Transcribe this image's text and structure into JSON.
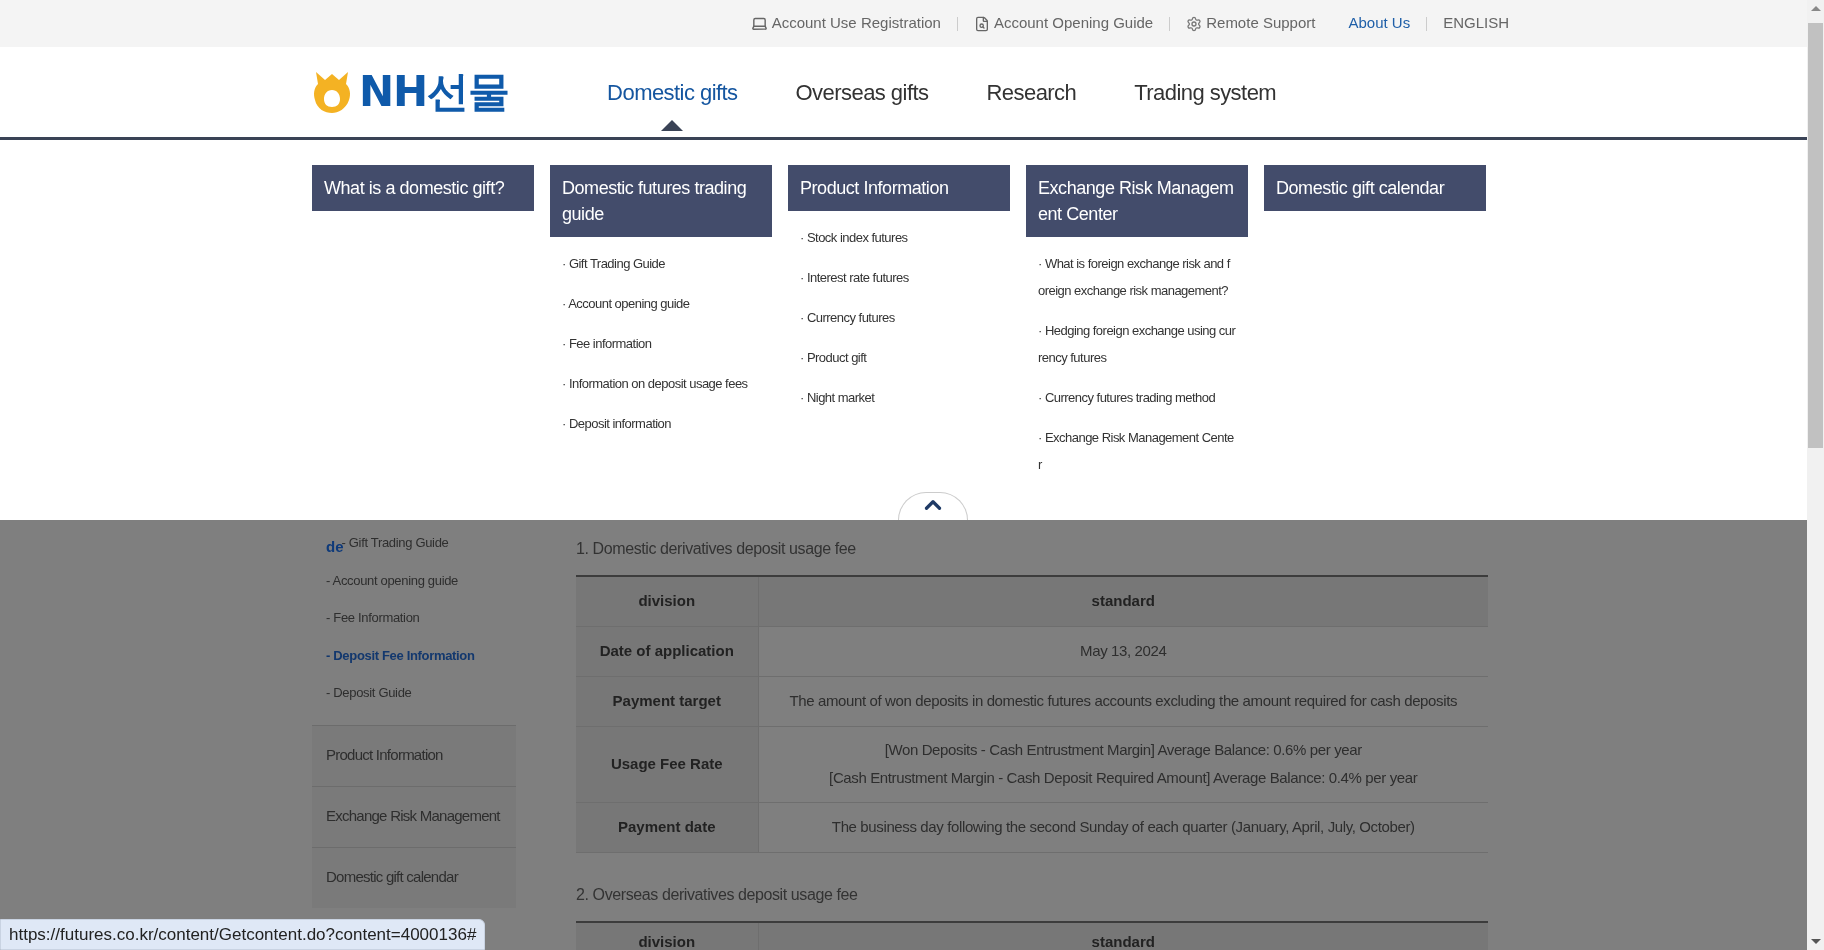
{
  "top_links": [
    {
      "label": "Account Use Registration",
      "kind": "monitor"
    },
    {
      "label": "Account Opening Guide",
      "kind": "document"
    },
    {
      "label": "Remote Support",
      "kind": "gear"
    },
    {
      "label": "About Us",
      "kind": "link"
    },
    {
      "label": "ENGLISH",
      "kind": "plain"
    }
  ],
  "logo": {
    "text": "NH선물"
  },
  "nav": [
    {
      "label": "Domestic gifts",
      "selected": true
    },
    {
      "label": "Overseas gifts",
      "selected": false
    },
    {
      "label": "Research",
      "selected": false
    },
    {
      "label": "Trading system",
      "selected": false
    }
  ],
  "mega_menu": [
    {
      "title": "What is a domestic gift?"
    },
    {
      "title": "Domestic futures trading guide",
      "items": [
        "· Gift Trading Guide",
        "· Account opening guide",
        "· Fee information",
        "· Information on deposit usage fees",
        "· Deposit information"
      ]
    },
    {
      "title": "Product Information",
      "items": [
        "· Stock index futures",
        "· Interest rate futures",
        "· Currency futures",
        "· Product gift",
        "· Night market"
      ]
    },
    {
      "title": "Exchange Risk Management Center",
      "items": [
        "· What is foreign exchange risk and foreign exchange risk management?",
        "· Hedging foreign exchange using currency futures",
        "· Currency futures trading method",
        "· Exchange Risk Management Center"
      ]
    },
    {
      "title": "Domestic gift calendar"
    }
  ],
  "sidebar": {
    "heading_fragment": "de",
    "sub_items": [
      {
        "label": "- Gift Trading Guide",
        "selected": false
      },
      {
        "label": "- Account opening guide",
        "selected": false
      },
      {
        "label": "- Fee Information",
        "selected": false
      },
      {
        "label": "- Deposit Fee Information",
        "selected": true
      },
      {
        "label": "- Deposit Guide",
        "selected": false
      }
    ],
    "sections": [
      "Product Information",
      "Exchange Risk Management",
      "Domestic gift calendar"
    ]
  },
  "content": {
    "section_1": {
      "title": "1. Domestic derivatives deposit usage fee",
      "columns": [
        "division",
        "standard"
      ],
      "rows": [
        {
          "label": "Date of application",
          "lines": [
            "May 13, 2024"
          ]
        },
        {
          "label": "Payment target",
          "lines": [
            "The amount of won deposits in domestic futures accounts excluding the amount required for cash deposits"
          ]
        },
        {
          "label": "Usage Fee Rate",
          "lines": [
            "[Won Deposits - Cash Entrustment Margin] Average Balance: 0.6% per year",
            "[Cash Entrustment Margin - Cash Deposit Required Amount] Average Balance: 0.4% per year"
          ]
        },
        {
          "label": "Payment date",
          "lines": [
            "The business day following the second Sunday of each quarter (January, April, July, October)"
          ]
        }
      ]
    },
    "section_2": {
      "title": "2. Overseas derivatives deposit usage fee",
      "columns": [
        "division",
        "standard"
      ]
    }
  },
  "status_url": "https://futures.co.kr/content/Getcontent.do?content=4000136#"
}
